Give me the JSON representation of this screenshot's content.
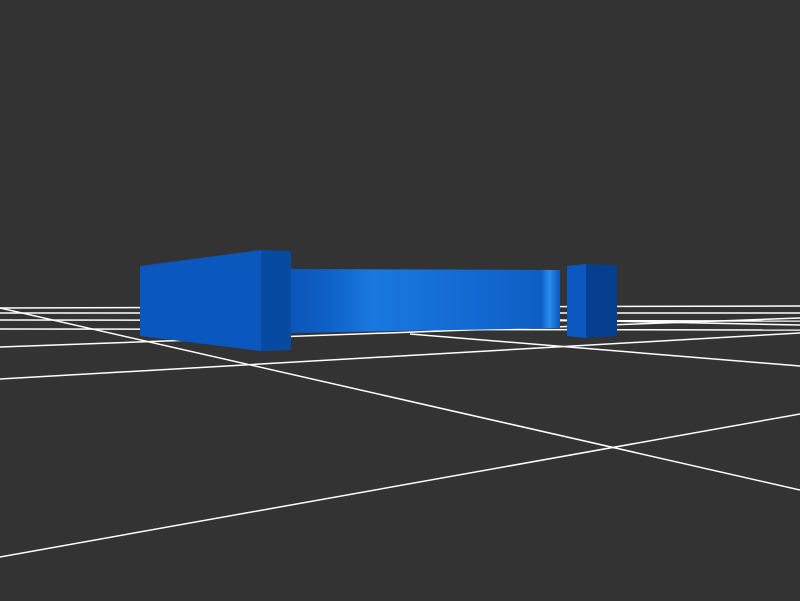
{
  "scene": {
    "background_color": "#333333",
    "grid_color": "#ffffff",
    "object": {
      "name": "blue-extruded-part",
      "color": "#1565c0"
    }
  }
}
